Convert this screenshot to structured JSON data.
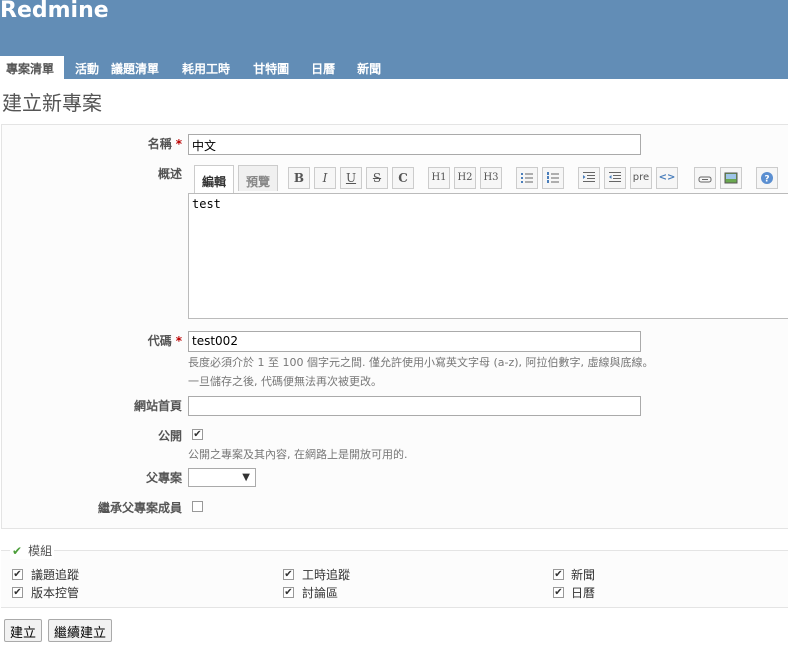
{
  "app_title": "Redmine",
  "menu": [
    "專案清單",
    "活動",
    "議題清單",
    "耗用工時",
    "甘特圖",
    "日曆",
    "新聞"
  ],
  "page_title": "建立新專案",
  "form": {
    "name_label": "名稱",
    "name_value": "中文",
    "required_mark": "*",
    "description_label": "概述",
    "tab_edit": "編輯",
    "tab_preview": "預覽",
    "toolbar": [
      "B",
      "I",
      "U",
      "S",
      "C",
      "H1",
      "H2",
      "H3",
      "ul",
      "ol",
      "indent-right",
      "indent-left",
      "pre",
      "<>",
      "link",
      "image",
      "help"
    ],
    "description_value": "test",
    "identifier_label": "代碼",
    "identifier_value": "test002",
    "identifier_hint1": "長度必須介於 1 至 100 個字元之間. 僅允許使用小寫英文字母 (a-z), 阿拉伯數字, 虛線與底線。",
    "identifier_hint2": "一旦儲存之後, 代碼便無法再次被更改。",
    "homepage_label": "網站首頁",
    "homepage_value": "",
    "public_label": "公開",
    "public_checked": true,
    "public_hint": "公開之專案及其內容, 在網路上是開放可用的.",
    "parent_label": "父專案",
    "inherit_label": "繼承父專案成員",
    "inherit_checked": false
  },
  "modules": {
    "legend": "模組",
    "items": [
      {
        "label": "議題追蹤",
        "checked": true
      },
      {
        "label": "工時追蹤",
        "checked": true
      },
      {
        "label": "新聞",
        "checked": true
      },
      {
        "label": "版本控管",
        "checked": true
      },
      {
        "label": "討論區",
        "checked": true
      },
      {
        "label": "日曆",
        "checked": true
      }
    ]
  },
  "buttons": {
    "create": "建立",
    "create_continue": "繼續建立"
  }
}
